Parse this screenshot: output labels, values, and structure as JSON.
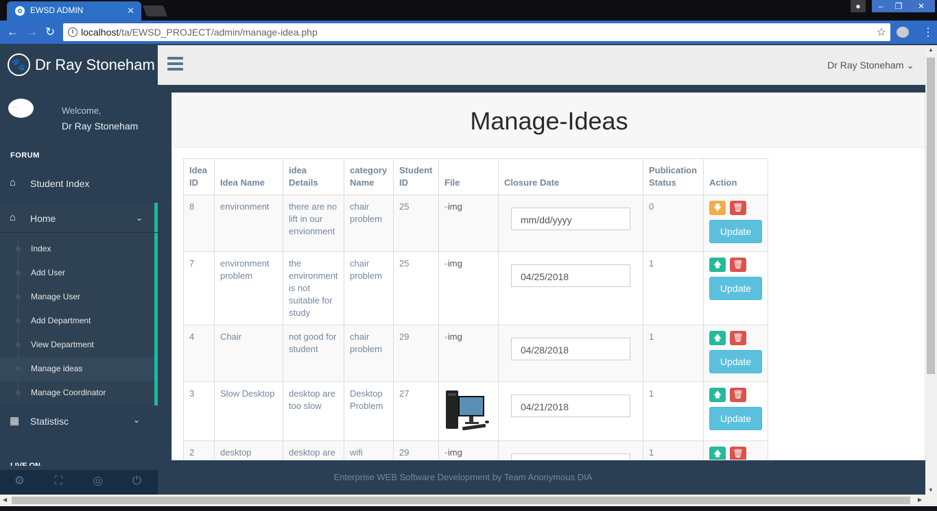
{
  "browser": {
    "tab_title": "EWSD ADMIN",
    "url_host": "localhost",
    "url_path": "/ta/EWSD_PROJECT/admin/manage-idea.php"
  },
  "sidebar": {
    "brand": "Dr Ray Stoneham",
    "avatar_alt": "...",
    "welcome": "Welcome,",
    "user_name": "Dr Ray Stoneham",
    "section": "FORUM",
    "student_index": "Student Index",
    "home": "Home",
    "home_items": [
      "Index",
      "Add User",
      "Manage User",
      "Add Department",
      "View Department",
      "Manage ideas",
      "Manage Coordinator"
    ],
    "active_item": "Manage ideas",
    "statistic": "Statistisc",
    "live_on": "LIVE ON"
  },
  "topnav": {
    "user_menu": "Dr Ray Stoneham"
  },
  "page": {
    "title": "Manage-Ideas"
  },
  "table": {
    "headers": [
      "Idea ID",
      "Idea Name",
      "idea Details",
      "category Name",
      "Student ID",
      "File",
      "Closure Date",
      "Publication Status",
      "Action"
    ],
    "update_label": "Update",
    "img_alt": "img",
    "rows": [
      {
        "id": "8",
        "name": "environment",
        "details": "there are no lift in our envionment",
        "category": "chair problem",
        "student": "25",
        "file": "broken",
        "date_placeholder": "mm/dd/yyyy",
        "date": "",
        "status": "0",
        "toggle": "down"
      },
      {
        "id": "7",
        "name": "environment problem",
        "details": "the environment is not suitable for study",
        "category": "chair problem",
        "student": "25",
        "file": "broken",
        "date_placeholder": "",
        "date": "04/25/2018",
        "status": "1",
        "toggle": "up"
      },
      {
        "id": "4",
        "name": "Chair",
        "details": "not good for student",
        "category": "chair problem",
        "student": "29",
        "file": "broken",
        "date_placeholder": "",
        "date": "04/28/2018",
        "status": "1",
        "toggle": "up"
      },
      {
        "id": "3",
        "name": "Slow Desktop",
        "details": "desktop are too slow",
        "category": "Desktop Problem",
        "student": "27",
        "file": "computer",
        "date_placeholder": "",
        "date": "04/21/2018",
        "status": "1",
        "toggle": "up"
      },
      {
        "id": "2",
        "name": "desktop",
        "details": "desktop are",
        "category": "wifi",
        "student": "29",
        "file": "broken",
        "date_placeholder": "",
        "date": "",
        "status": "1",
        "toggle": "up"
      }
    ]
  },
  "footer": {
    "text": "Enterprise WEB Software Development by Team Anonymous DIA"
  },
  "colors": {
    "sidebar_bg": "#2a3f54",
    "accent_green": "#1abb9c",
    "update_blue": "#5bc0de",
    "delete_red": "#d9534f",
    "publish_green": "#26b99a",
    "unpublish_orange": "#f0ad4e"
  },
  "icons": {
    "brand": "paw-icon",
    "home": "home-icon",
    "statistic": "table-icon",
    "footer": [
      "gear-icon",
      "fullscreen-icon",
      "eye-slash-icon",
      "power-icon"
    ]
  }
}
